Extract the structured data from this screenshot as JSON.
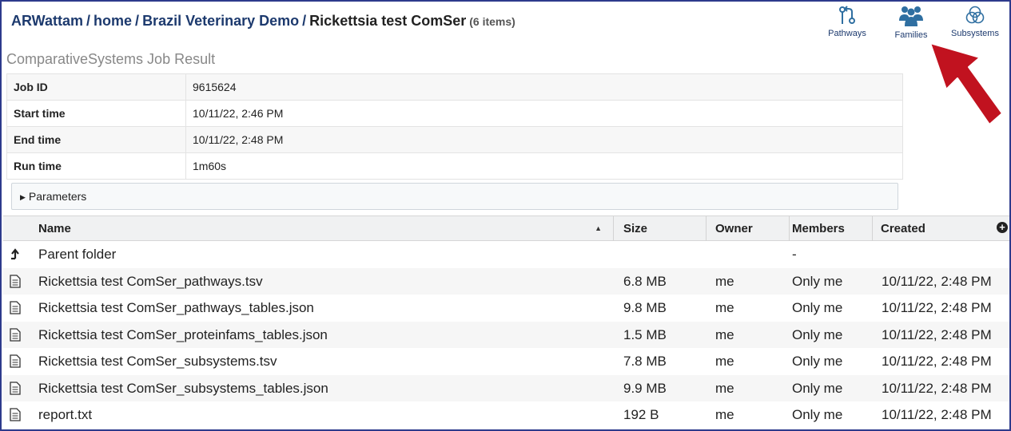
{
  "breadcrumb": {
    "user": "ARWattam",
    "home": "home",
    "folder": "Brazil Veterinary Demo",
    "current": "Rickettsia test ComSer",
    "count": "(6 items)",
    "separator": "/"
  },
  "actions": [
    {
      "label": "Pathways",
      "icon": "pathways-icon"
    },
    {
      "label": "Families",
      "icon": "families-icon"
    },
    {
      "label": "Subsystems",
      "icon": "subsystems-icon"
    }
  ],
  "accent_color": "#c1121f",
  "section_title": "ComparativeSystems Job Result",
  "job": {
    "rows": [
      {
        "key": "Job ID",
        "value": "9615624"
      },
      {
        "key": "Start time",
        "value": "10/11/22, 2:46 PM"
      },
      {
        "key": "End time",
        "value": "10/11/22, 2:48 PM"
      },
      {
        "key": "Run time",
        "value": "1m60s"
      }
    ],
    "parameters_label": "Parameters"
  },
  "grid": {
    "columns": {
      "name": "Name",
      "size": "Size",
      "owner": "Owner",
      "members": "Members",
      "created": "Created"
    },
    "parent": {
      "name": "Parent folder",
      "members": "-"
    },
    "files": [
      {
        "name": "Rickettsia test ComSer_pathways.tsv",
        "size": "6.8 MB",
        "owner": "me",
        "members": "Only me",
        "created": "10/11/22, 2:48 PM"
      },
      {
        "name": "Rickettsia test ComSer_pathways_tables.json",
        "size": "9.8 MB",
        "owner": "me",
        "members": "Only me",
        "created": "10/11/22, 2:48 PM"
      },
      {
        "name": "Rickettsia test ComSer_proteinfams_tables.json",
        "size": "1.5 MB",
        "owner": "me",
        "members": "Only me",
        "created": "10/11/22, 2:48 PM"
      },
      {
        "name": "Rickettsia test ComSer_subsystems.tsv",
        "size": "7.8 MB",
        "owner": "me",
        "members": "Only me",
        "created": "10/11/22, 2:48 PM"
      },
      {
        "name": "Rickettsia test ComSer_subsystems_tables.json",
        "size": "9.9 MB",
        "owner": "me",
        "members": "Only me",
        "created": "10/11/22, 2:48 PM"
      },
      {
        "name": "report.txt",
        "size": "192 B",
        "owner": "me",
        "members": "Only me",
        "created": "10/11/22, 2:48 PM"
      }
    ]
  }
}
